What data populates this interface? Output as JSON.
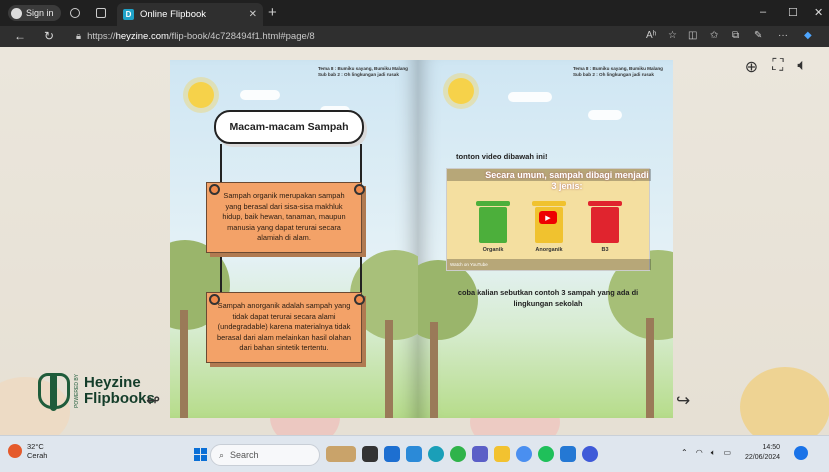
{
  "browser": {
    "profile_label": "Sign in",
    "tab_title": "Online Flipbook",
    "tab_favicon_letter": "D",
    "new_tab": "+",
    "url_prefix": "https://",
    "url_host": "heyzine.com",
    "url_path": "/flip-book/4c728494f1.html#page/8",
    "read_aloud": "Aʰ",
    "window_controls": {
      "minimize": "–",
      "maximize": "☐",
      "close": "✕"
    }
  },
  "viewer": {
    "toolbar_icons": [
      "zoom-in-icon",
      "fullscreen-icon",
      "sound-icon"
    ],
    "logo_top": "Heyzine",
    "logo_bottom": "Flipbooks",
    "logo_vertical": "POWERED BY",
    "prev_icon": "↫",
    "next_icon": "↪"
  },
  "left_page": {
    "header_line1": "Tema 8 : Bumiku sayang, Bumiku Malang",
    "header_line2": "Sub bab 2 : Oh lingkungan jadi rusak",
    "title": "Macam-macam Sampah",
    "card1": "Sampah organik merupakan sampah yang berasal dari sisa-sisa makhluk hidup, baik hewan, tanaman, maupun manusia yang dapat terurai secara alamiah di alam.",
    "card2": "Sampah anorganik adalah sampah yang tidak dapat terurai secara alami (undegradable) karena materialnya tidak berasal dari alam melainkan hasil olahan dari bahan sintetik tertentu."
  },
  "right_page": {
    "header_line1": "Tema 8 : Bumiku sayang, Bumiku Malang",
    "header_line2": "Sub bab 2 : Oh lingkungan jadi rusak",
    "instruction": "tonton video dibawah ini!",
    "video_title": "Secara umum, sampah dibagi menjadi 3 jenis:",
    "bins": [
      {
        "label": "Organik",
        "color": "#4caf3b"
      },
      {
        "label": "Anorganik",
        "color": "#f0c22f"
      },
      {
        "label": "B3",
        "color": "#e0242e"
      }
    ],
    "watch_on": "Watch on YouTube",
    "question": "coba kalian sebutkan contoh 3 sampah yang ada di lingkungan sekolah"
  },
  "taskbar": {
    "temperature": "32°C",
    "weather": "Cerah",
    "search_placeholder": "Search",
    "time": "14:50",
    "date": "22/06/2024"
  }
}
